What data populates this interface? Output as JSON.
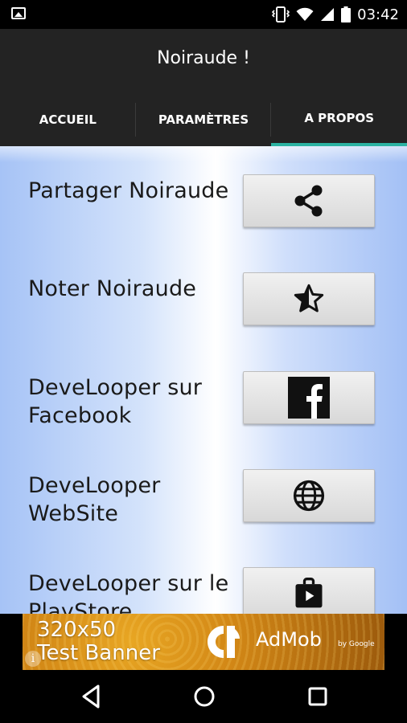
{
  "status": {
    "time": "03:42",
    "icons": [
      "picture-icon",
      "vibrate-icon",
      "wifi-icon",
      "signal-icon",
      "battery-icon"
    ]
  },
  "app": {
    "title": "Noiraude !"
  },
  "tabs": [
    {
      "label": "ACCUEIL",
      "active": false
    },
    {
      "label": "PARAMÈTRES",
      "active": false
    },
    {
      "label": "A PROPOS",
      "active": true
    }
  ],
  "rows": [
    {
      "label": "Partager Noiraude",
      "icon": "share-icon"
    },
    {
      "label": "Noter Noiraude",
      "icon": "star-half-icon"
    },
    {
      "label": "DeveLooper sur Facebook",
      "icon": "facebook-icon"
    },
    {
      "label": "DeveLooper WebSite",
      "icon": "globe-icon"
    },
    {
      "label": "DeveLooper sur le PlayStore",
      "icon": "shop-icon"
    }
  ],
  "ad": {
    "line1": "320x50",
    "line2": "Test Banner",
    "brand": "AdMob",
    "by": "by Google",
    "info": "i"
  },
  "nav": {
    "icons": [
      "back-icon",
      "home-icon",
      "recents-icon"
    ]
  },
  "colors": {
    "accent": "#2bb3a2",
    "app_bar": "#232323"
  }
}
